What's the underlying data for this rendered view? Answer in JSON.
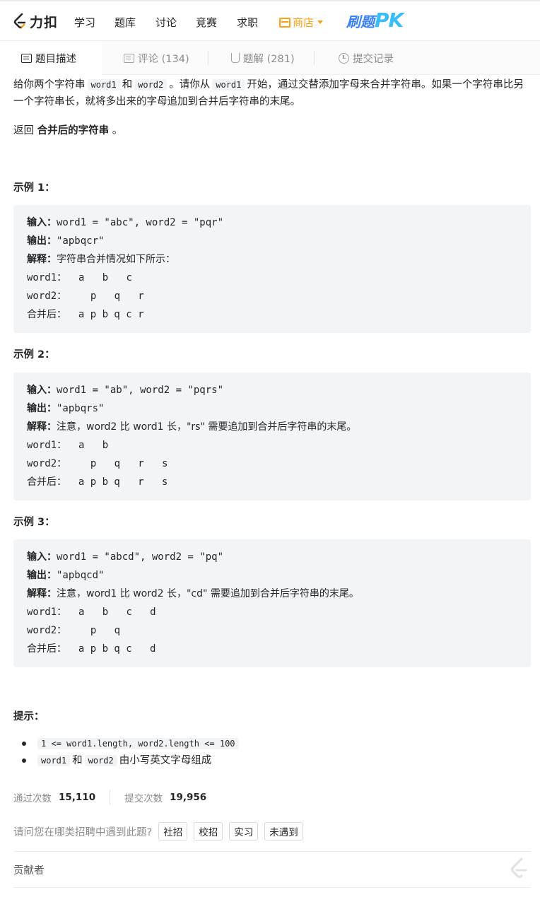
{
  "nav": {
    "brand": "力扣",
    "items": [
      "学习",
      "题库",
      "讨论",
      "竞赛",
      "求职"
    ],
    "shop": "商店",
    "promo_cn": "刷题",
    "promo_en": "PK"
  },
  "tabs": [
    {
      "label": "题目描述"
    },
    {
      "label": "评论 (134)"
    },
    {
      "label": "题解 (281)"
    },
    {
      "label": "提交记录"
    }
  ],
  "description": {
    "p1_a": "给你两个字符串",
    "code_word1": "word1",
    "p1_and": "和",
    "code_word2": "word2",
    "p1_b": "。请你从",
    "p1_c": "开始，通过交替添加字母来合并字符串。如果一个字符串比另一个字符串长，就将多出来的字母追加到合并后字符串的末尾。",
    "p2_a": "返回",
    "p2_bold": "合并后的字符串",
    "p2_end": "。"
  },
  "examples": [
    {
      "title": "示例 1：",
      "input_label": "输入：",
      "input": "word1 = \"abc\", word2 = \"pqr\"",
      "output_label": "输出：",
      "output": "\"apbqcr\"",
      "explain_label": "解释：",
      "explain": "字符串合并情况如下所示：",
      "row1_label": "word1：",
      "row1": "  a   b   c",
      "row2_label": "word2：",
      "row2": "    p   q   r",
      "row3_label": "合并后：",
      "row3": "  a p b q c r"
    },
    {
      "title": "示例 2：",
      "input_label": "输入：",
      "input": "word1 = \"ab\", word2 = \"pqrs\"",
      "output_label": "输出：",
      "output": "\"apbqrs\"",
      "explain_label": "解释：",
      "explain": "注意，word2 比 word1 长，\"rs\" 需要追加到合并后字符串的末尾。",
      "row1_label": "word1：",
      "row1": "  a   b",
      "row2_label": "word2：",
      "row2": "    p   q   r   s",
      "row3_label": "合并后：",
      "row3": "  a p b q   r   s"
    },
    {
      "title": "示例 3：",
      "input_label": "输入：",
      "input": "word1 = \"abcd\", word2 = \"pq\"",
      "output_label": "输出：",
      "output": "\"apbqcd\"",
      "explain_label": "解释：",
      "explain": "注意，word1 比 word2 长，\"cd\" 需要追加到合并后字符串的末尾。",
      "row1_label": "word1：",
      "row1": "  a   b   c   d",
      "row2_label": "word2：",
      "row2": "    p   q",
      "row3_label": "合并后：",
      "row3": "  a p b q c   d"
    }
  ],
  "hints": {
    "title": "提示：",
    "h1_code": "1 <= word1.length, word2.length <= 100",
    "h2_code1": "word1",
    "h2_and": "和",
    "h2_code2": "word2",
    "h2_text": "由小写英文字母组成"
  },
  "stats": {
    "accepted_label": "通过次数",
    "accepted_value": "15,110",
    "submitted_label": "提交次数",
    "submitted_value": "19,956"
  },
  "recruit": {
    "question": "请问您在哪类招聘中遇到此题?",
    "options": [
      "社招",
      "校招",
      "实习",
      "未遇到"
    ]
  },
  "contributors": {
    "label": "贡献者"
  },
  "colors": {
    "accent": "#ffa116",
    "code_bg": "#f3f4f5",
    "text": "#262626",
    "muted": "#8c8c8c"
  }
}
